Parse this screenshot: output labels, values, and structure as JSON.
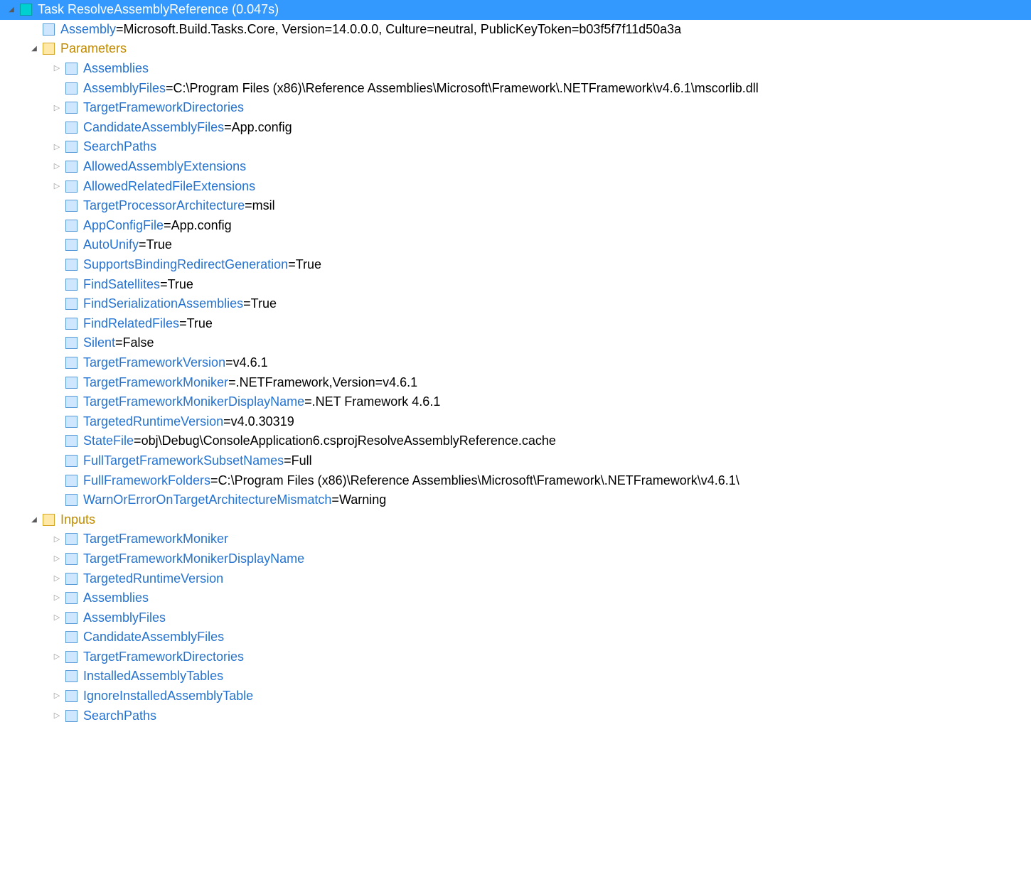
{
  "rows": [
    {
      "indent": 0,
      "expander": "expanded",
      "icon": "cyan",
      "selected": true,
      "labelColor": "white",
      "label": "Task ResolveAssemblyReference (0.047s)",
      "value": null
    },
    {
      "indent": 1,
      "expander": "none",
      "icon": "blue",
      "selected": false,
      "labelColor": "blue",
      "label": "Assembly",
      "eq": " = ",
      "value": "Microsoft.Build.Tasks.Core, Version=14.0.0.0, Culture=neutral, PublicKeyToken=b03f5f7f11d50a3a"
    },
    {
      "indent": 1,
      "expander": "expanded",
      "icon": "gold",
      "selected": false,
      "labelColor": "gold",
      "label": "Parameters",
      "value": null
    },
    {
      "indent": 2,
      "expander": "collapsed",
      "icon": "blue",
      "selected": false,
      "labelColor": "blue",
      "label": "Assemblies",
      "value": null
    },
    {
      "indent": 2,
      "expander": "none",
      "icon": "blue",
      "selected": false,
      "labelColor": "blue",
      "label": "AssemblyFiles",
      "eq": " = ",
      "value": "C:\\Program Files (x86)\\Reference Assemblies\\Microsoft\\Framework\\.NETFramework\\v4.6.1\\mscorlib.dll"
    },
    {
      "indent": 2,
      "expander": "collapsed",
      "icon": "blue",
      "selected": false,
      "labelColor": "blue",
      "label": "TargetFrameworkDirectories",
      "value": null
    },
    {
      "indent": 2,
      "expander": "none",
      "icon": "blue",
      "selected": false,
      "labelColor": "blue",
      "label": "CandidateAssemblyFiles",
      "eq": " = ",
      "value": "App.config"
    },
    {
      "indent": 2,
      "expander": "collapsed",
      "icon": "blue",
      "selected": false,
      "labelColor": "blue",
      "label": "SearchPaths",
      "value": null
    },
    {
      "indent": 2,
      "expander": "collapsed",
      "icon": "blue",
      "selected": false,
      "labelColor": "blue",
      "label": "AllowedAssemblyExtensions",
      "value": null
    },
    {
      "indent": 2,
      "expander": "collapsed",
      "icon": "blue",
      "selected": false,
      "labelColor": "blue",
      "label": "AllowedRelatedFileExtensions",
      "value": null
    },
    {
      "indent": 2,
      "expander": "none",
      "icon": "blue",
      "selected": false,
      "labelColor": "blue",
      "label": "TargetProcessorArchitecture",
      "eq": " = ",
      "value": "msil"
    },
    {
      "indent": 2,
      "expander": "none",
      "icon": "blue",
      "selected": false,
      "labelColor": "blue",
      "label": "AppConfigFile",
      "eq": " = ",
      "value": "App.config"
    },
    {
      "indent": 2,
      "expander": "none",
      "icon": "blue",
      "selected": false,
      "labelColor": "blue",
      "label": "AutoUnify",
      "eq": " = ",
      "value": "True"
    },
    {
      "indent": 2,
      "expander": "none",
      "icon": "blue",
      "selected": false,
      "labelColor": "blue",
      "label": "SupportsBindingRedirectGeneration",
      "eq": " = ",
      "value": "True"
    },
    {
      "indent": 2,
      "expander": "none",
      "icon": "blue",
      "selected": false,
      "labelColor": "blue",
      "label": "FindSatellites",
      "eq": " = ",
      "value": "True"
    },
    {
      "indent": 2,
      "expander": "none",
      "icon": "blue",
      "selected": false,
      "labelColor": "blue",
      "label": "FindSerializationAssemblies",
      "eq": " = ",
      "value": "True"
    },
    {
      "indent": 2,
      "expander": "none",
      "icon": "blue",
      "selected": false,
      "labelColor": "blue",
      "label": "FindRelatedFiles",
      "eq": " = ",
      "value": "True"
    },
    {
      "indent": 2,
      "expander": "none",
      "icon": "blue",
      "selected": false,
      "labelColor": "blue",
      "label": "Silent",
      "eq": " = ",
      "value": "False"
    },
    {
      "indent": 2,
      "expander": "none",
      "icon": "blue",
      "selected": false,
      "labelColor": "blue",
      "label": "TargetFrameworkVersion",
      "eq": " = ",
      "value": "v4.6.1"
    },
    {
      "indent": 2,
      "expander": "none",
      "icon": "blue",
      "selected": false,
      "labelColor": "blue",
      "label": "TargetFrameworkMoniker",
      "eq": " = ",
      "value": ".NETFramework,Version=v4.6.1"
    },
    {
      "indent": 2,
      "expander": "none",
      "icon": "blue",
      "selected": false,
      "labelColor": "blue",
      "label": "TargetFrameworkMonikerDisplayName",
      "eq": " = ",
      "value": ".NET Framework 4.6.1"
    },
    {
      "indent": 2,
      "expander": "none",
      "icon": "blue",
      "selected": false,
      "labelColor": "blue",
      "label": "TargetedRuntimeVersion",
      "eq": " = ",
      "value": "v4.0.30319"
    },
    {
      "indent": 2,
      "expander": "none",
      "icon": "blue",
      "selected": false,
      "labelColor": "blue",
      "label": "StateFile",
      "eq": " = ",
      "value": "obj\\Debug\\ConsoleApplication6.csprojResolveAssemblyReference.cache"
    },
    {
      "indent": 2,
      "expander": "none",
      "icon": "blue",
      "selected": false,
      "labelColor": "blue",
      "label": "FullTargetFrameworkSubsetNames",
      "eq": " = ",
      "value": "Full"
    },
    {
      "indent": 2,
      "expander": "none",
      "icon": "blue",
      "selected": false,
      "labelColor": "blue",
      "label": "FullFrameworkFolders",
      "eq": " = ",
      "value": "C:\\Program Files (x86)\\Reference Assemblies\\Microsoft\\Framework\\.NETFramework\\v4.6.1\\"
    },
    {
      "indent": 2,
      "expander": "none",
      "icon": "blue",
      "selected": false,
      "labelColor": "blue",
      "label": "WarnOrErrorOnTargetArchitectureMismatch",
      "eq": " = ",
      "value": "Warning"
    },
    {
      "indent": 1,
      "expander": "expanded",
      "icon": "gold",
      "selected": false,
      "labelColor": "gold",
      "label": "Inputs",
      "value": null
    },
    {
      "indent": 2,
      "expander": "collapsed",
      "icon": "blue",
      "selected": false,
      "labelColor": "blue",
      "label": "TargetFrameworkMoniker",
      "value": null
    },
    {
      "indent": 2,
      "expander": "collapsed",
      "icon": "blue",
      "selected": false,
      "labelColor": "blue",
      "label": "TargetFrameworkMonikerDisplayName",
      "value": null
    },
    {
      "indent": 2,
      "expander": "collapsed",
      "icon": "blue",
      "selected": false,
      "labelColor": "blue",
      "label": "TargetedRuntimeVersion",
      "value": null
    },
    {
      "indent": 2,
      "expander": "collapsed",
      "icon": "blue",
      "selected": false,
      "labelColor": "blue",
      "label": "Assemblies",
      "value": null
    },
    {
      "indent": 2,
      "expander": "collapsed",
      "icon": "blue",
      "selected": false,
      "labelColor": "blue",
      "label": "AssemblyFiles",
      "value": null
    },
    {
      "indent": 2,
      "expander": "none",
      "icon": "blue",
      "selected": false,
      "labelColor": "blue",
      "label": "CandidateAssemblyFiles",
      "value": null
    },
    {
      "indent": 2,
      "expander": "collapsed",
      "icon": "blue",
      "selected": false,
      "labelColor": "blue",
      "label": "TargetFrameworkDirectories",
      "value": null
    },
    {
      "indent": 2,
      "expander": "none",
      "icon": "blue",
      "selected": false,
      "labelColor": "blue",
      "label": "InstalledAssemblyTables",
      "value": null
    },
    {
      "indent": 2,
      "expander": "collapsed",
      "icon": "blue",
      "selected": false,
      "labelColor": "blue",
      "label": "IgnoreInstalledAssemblyTable",
      "value": null
    },
    {
      "indent": 2,
      "expander": "collapsed",
      "icon": "blue",
      "selected": false,
      "labelColor": "blue",
      "label": "SearchPaths",
      "value": null
    }
  ]
}
